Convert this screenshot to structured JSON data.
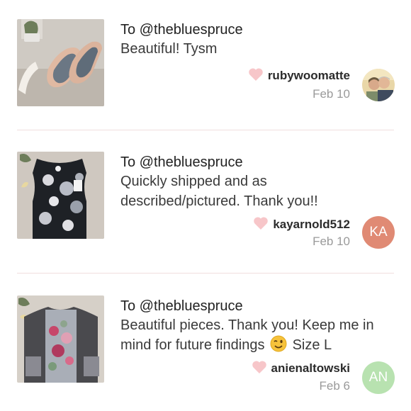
{
  "reviews": [
    {
      "to": "To @thebluespruce",
      "comment_parts": [
        "Beautiful! Tysm"
      ],
      "username": "rubywoomatte",
      "date": "Feb 10",
      "avatar": {
        "type": "photo",
        "initials": ""
      },
      "thumb": "shoes"
    },
    {
      "to": "To @thebluespruce",
      "comment_parts": [
        "Quickly shipped and as",
        "described/pictured. Thank you!!"
      ],
      "username": "kayarnold512",
      "date": "Feb 10",
      "avatar": {
        "type": "initials",
        "initials": "KA",
        "color": "#e08a74"
      },
      "thumb": "floral-top"
    },
    {
      "to": "To @thebluespruce",
      "comment_parts": [
        "Beautiful pieces. Thank you! Keep me in",
        "mind for future findings",
        "Size L"
      ],
      "username": "anienaltowski",
      "date": "Feb 6",
      "avatar": {
        "type": "initials",
        "initials": "AN",
        "color": "#b8e2b0"
      },
      "thumb": "sweater"
    }
  ],
  "icons": {
    "heart": "heart-icon",
    "wink": "winking-face-emoji"
  },
  "colors": {
    "heart": "#f7c6c9",
    "divider": "#f0dede",
    "date": "#9a9a9a"
  }
}
